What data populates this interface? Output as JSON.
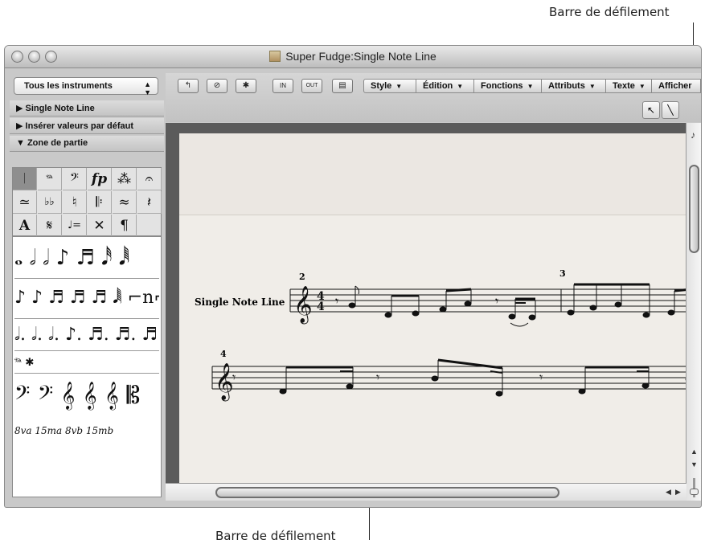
{
  "callouts": {
    "top": "Barre de défilement",
    "bottom": "Barre de défilement"
  },
  "window": {
    "title": "Super Fudge:Single Note Line"
  },
  "inspector": {
    "instrument_select": "Tous les instruments",
    "sections": [
      {
        "label": "Single Note Line",
        "expanded": false
      },
      {
        "label": "Insérer valeurs par défaut",
        "expanded": false
      },
      {
        "label": "Zone de partie",
        "expanded": true
      }
    ],
    "palette_symbols": [
      "𝄀",
      "𝆮",
      "𝄢",
      "fp",
      "⁂",
      "𝄐",
      "≃",
      "♭♭",
      "♮",
      "𝄆",
      "≈",
      "𝄽",
      "A",
      "𝄋",
      "♩=",
      "✕",
      "¶"
    ],
    "note_rows": [
      "𝅝 𝅗𝅥 𝅗𝅥 ♪ ♬ 𝅘𝅥𝅰 𝅘𝅥𝅱",
      "♪ ♪ ♬ ♬ ♬ 𝅘𝅥𝅲 ⌐n⌐",
      "𝅗𝅥. 𝅗𝅥. 𝅗𝅥. ♪. ♬. ♬. ♬.",
      "𝆮 ✱",
      "𝄢 𝄢 𝄞 𝄞 𝄞 𝄡",
      "8va 15ma 8vb 15mb"
    ]
  },
  "toolbar": {
    "buttons": [
      "↰",
      "⊘",
      "✱",
      "IN",
      "OUT",
      "▤"
    ],
    "menus": [
      "Style",
      "Édition",
      "Fonctions",
      "Attributs",
      "Texte",
      "Afficher"
    ],
    "tools": [
      "pointer-tool",
      "pencil-tool"
    ]
  },
  "score": {
    "staff_label": "Single Note Line",
    "bar_numbers": [
      "2",
      "3",
      "4"
    ],
    "time_signature": "4/4"
  }
}
